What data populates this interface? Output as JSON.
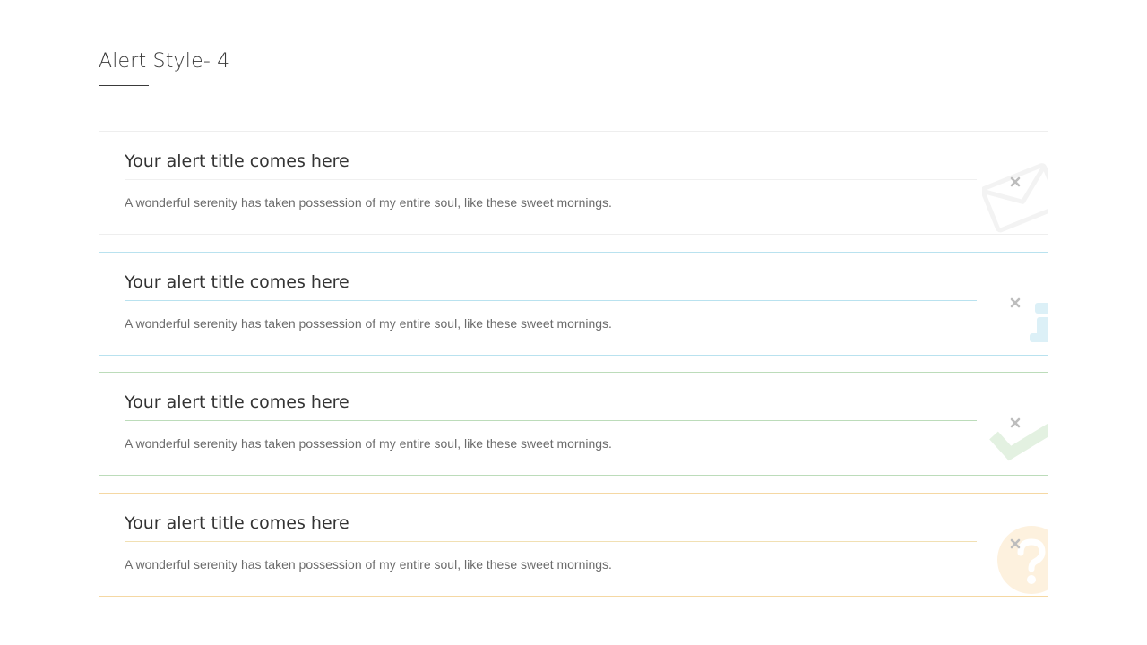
{
  "section": {
    "title": "Alert Style- 4"
  },
  "alerts": [
    {
      "variant": "default",
      "title": "Your alert title comes here",
      "message": "A wonderful serenity has taken possession of my entire soul, like these sweet mornings.",
      "icon": "envelope-icon",
      "color": "#eeeeee"
    },
    {
      "variant": "info",
      "title": "Your alert title comes here",
      "message": "A wonderful serenity has taken possession of my entire soul, like these sweet mornings.",
      "icon": "info-icon",
      "color": "#b9e2ef"
    },
    {
      "variant": "success",
      "title": "Your alert title comes here",
      "message": "A wonderful serenity has taken possession of my entire soul, like these sweet mornings.",
      "icon": "checkmark-icon",
      "color": "#bcdcba"
    },
    {
      "variant": "warning",
      "title": "Your alert title comes here",
      "message": "A wonderful serenity has taken possession of my entire soul, like these sweet mornings.",
      "icon": "question-icon",
      "color": "#f5d8a3"
    }
  ]
}
